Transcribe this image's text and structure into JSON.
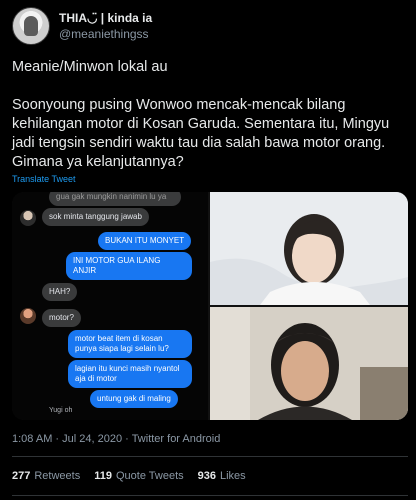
{
  "user": {
    "display_name": "THIA◡̈ | kinda ia",
    "handle": "@meaniethingss"
  },
  "tweet": {
    "paragraphs": [
      "Meanie/Minwon lokal au",
      "Soonyoung pusing Wonwoo mencak-mencak bilang kehilangan motor di Kosan Garuda. Sementara itu, Mingyu jadi tengsin sendiri waktu tau dia salah bawa motor orang. Gimana ya kelanjutannya?"
    ],
    "translate_label": "Translate Tweet"
  },
  "chat": {
    "messages": [
      {
        "side": "recv",
        "text": "gua gak mungkin nanimin lu ya"
      },
      {
        "side": "recv",
        "text": "sok minta tanggung jawab"
      },
      {
        "side": "sent",
        "text": "BUKAN ITU MONYET"
      },
      {
        "side": "sent",
        "text": "INI MOTOR GUA ILANG ANJIR"
      },
      {
        "side": "recv",
        "text": "HAH?"
      },
      {
        "side": "recv",
        "text": "motor?"
      },
      {
        "side": "sent",
        "text": "motor beat item di kosan punya siapa lagi selain lu?"
      },
      {
        "side": "sent",
        "text": "lagian itu kunci masih nyantol aja di motor"
      },
      {
        "side": "sent",
        "text": "untung gak di maling"
      }
    ],
    "seen_label": "Yugi oh"
  },
  "meta": {
    "time": "1:08 AM",
    "date": "Jul 24, 2020",
    "source": "Twitter for Android"
  },
  "stats": {
    "retweets_count": "277",
    "retweets_label": "Retweets",
    "quotes_count": "119",
    "quotes_label": "Quote Tweets",
    "likes_count": "936",
    "likes_label": "Likes"
  },
  "colors": {
    "background": "#000000",
    "text": "#e7e9ea",
    "secondary": "#8b98a5",
    "link": "#1d9bf0",
    "sent_bubble": "#1877f2",
    "received_bubble": "#3a3b3c"
  }
}
